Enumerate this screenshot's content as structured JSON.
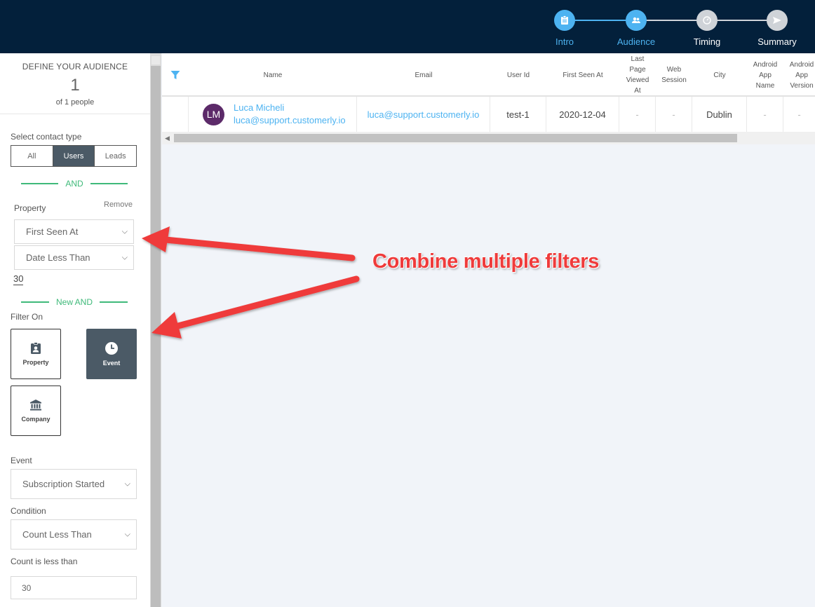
{
  "steps": [
    {
      "label": "Intro",
      "icon": "clipboard-icon",
      "state": "active"
    },
    {
      "label": "Audience",
      "icon": "users-icon",
      "state": "active"
    },
    {
      "label": "Timing",
      "icon": "clock-icon",
      "state": "inactive"
    },
    {
      "label": "Summary",
      "icon": "send-icon",
      "state": "inactive"
    }
  ],
  "audience": {
    "title": "DEFINE YOUR AUDIENCE",
    "count": "1",
    "of_text": "of 1 people"
  },
  "contact_type": {
    "label": "Select contact type",
    "options": [
      "All",
      "Users",
      "Leads"
    ],
    "selected": "Users"
  },
  "and_label": "AND",
  "property": {
    "label": "Property",
    "remove": "Remove",
    "field": "First Seen At",
    "operator": "Date Less Than",
    "value": "30"
  },
  "new_and_label": "New AND",
  "filter_on": {
    "label": "Filter On",
    "property": "Property",
    "event": "Event",
    "company": "Company"
  },
  "event": {
    "label": "Event",
    "value": "Subscription Started"
  },
  "condition": {
    "label": "Condition",
    "value": "Count Less Than"
  },
  "count": {
    "label": "Count is less than",
    "value": "30"
  },
  "table": {
    "headers": {
      "name": "Name",
      "email": "Email",
      "user_id": "User Id",
      "first_seen": "First Seen At",
      "last_page_1": "Last",
      "last_page_2": "Page",
      "last_page_3": "Viewed",
      "last_page_4": "At",
      "web_1": "Web",
      "web_2": "Session",
      "city": "City",
      "android_name_1": "Android",
      "android_name_2": "App",
      "android_name_3": "Name",
      "android_ver_1": "Android",
      "android_ver_2": "App",
      "android_ver_3": "Version"
    },
    "row": {
      "initials": "LM",
      "name": "Luca Micheli",
      "name_email": "luca@support.customerly.io",
      "email": "luca@support.customerly.io",
      "user_id": "test-1",
      "first_seen": "2020-12-04",
      "last_page": "-",
      "web_session": "-",
      "city": "Dublin",
      "android_name": "-",
      "android_version": "-"
    }
  },
  "annotation": "Combine multiple filters",
  "colors": {
    "topbar": "#03203b",
    "accent": "#4db3f1",
    "green": "#3fba7a",
    "annotation": "#ef3b3b"
  }
}
